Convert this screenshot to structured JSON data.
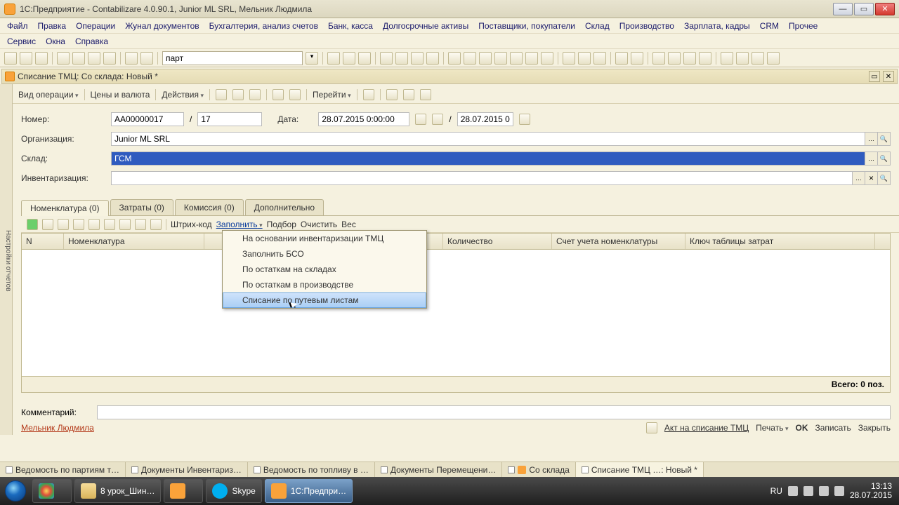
{
  "window": {
    "title": "1С:Предприятие - Contabilizare 4.0.90.1, Junior ML SRL, Мельник Людмила"
  },
  "menu1": [
    "Файл",
    "Правка",
    "Операции",
    "Жунал документов",
    "Бухгалтерия, анализ счетов",
    "Банк, касса",
    "Долгосрочные активы",
    "Поставщики, покупатели",
    "Склад",
    "Производство",
    "Зарплата, кадры",
    "CRM",
    "Прочее"
  ],
  "menu2": [
    "Сервис",
    "Окна",
    "Справка"
  ],
  "global_toolbar": {
    "search_value": "парт"
  },
  "sidebar_label": "Настройки отчетов",
  "doc": {
    "title": "Списание ТМЦ: Со склада: Новый *",
    "toolbar": {
      "op": "Вид операции",
      "prices": "Цены и валюта",
      "actions": "Действия",
      "goto": "Перейти"
    }
  },
  "form": {
    "number_label": "Номер:",
    "number": "АА00000017",
    "number2": "17",
    "date_label": "Дата:",
    "date1": "28.07.2015 0:00:00",
    "date2": "28.07.2015 0:",
    "org_label": "Организация:",
    "org": "Junior ML SRL",
    "wh_label": "Склад:",
    "wh": "ГСМ",
    "inv_label": "Инвентаризация:",
    "inv": ""
  },
  "tabs": [
    "Номенклатура (0)",
    "Затраты (0)",
    "Комиссия (0)",
    "Дополнительно"
  ],
  "grid_tb": {
    "barcode": "Штрих-код",
    "fill": "Заполнить",
    "pick": "Подбор",
    "clear": "Очистить",
    "weight": "Вес"
  },
  "grid_cols": [
    "N",
    "Номенклатура",
    "",
    "Количество",
    "Счет учета номенклатуры",
    "Ключ таблицы затрат"
  ],
  "dropdown": [
    "На основании инвентаризации ТМЦ",
    "Заполнить БСО",
    "По остаткам на складах",
    "По остаткам в производстве",
    "Списание по путевым листам"
  ],
  "total": "Всего: 0 поз.",
  "comment_label": "Комментарий:",
  "user": "Мельник Людмила",
  "footer_actions": {
    "act": "Акт на списание ТМЦ",
    "print": "Печать",
    "ok": "OK",
    "save": "Записать",
    "close": "Закрыть"
  },
  "wnd_tabs": [
    "Ведомость по партиям т…",
    "Документы Инвентариз…",
    "Ведомость по топливу в …",
    "Документы Перемещени…",
    "Со склада",
    "Списание ТМЦ …: Новый *"
  ],
  "taskbar": {
    "items": [
      "",
      "",
      "8 урок_Шин…",
      "",
      "Skype",
      "1С:Предпри…"
    ],
    "lang": "RU",
    "time": "13:13",
    "date": "28.07.2015"
  }
}
